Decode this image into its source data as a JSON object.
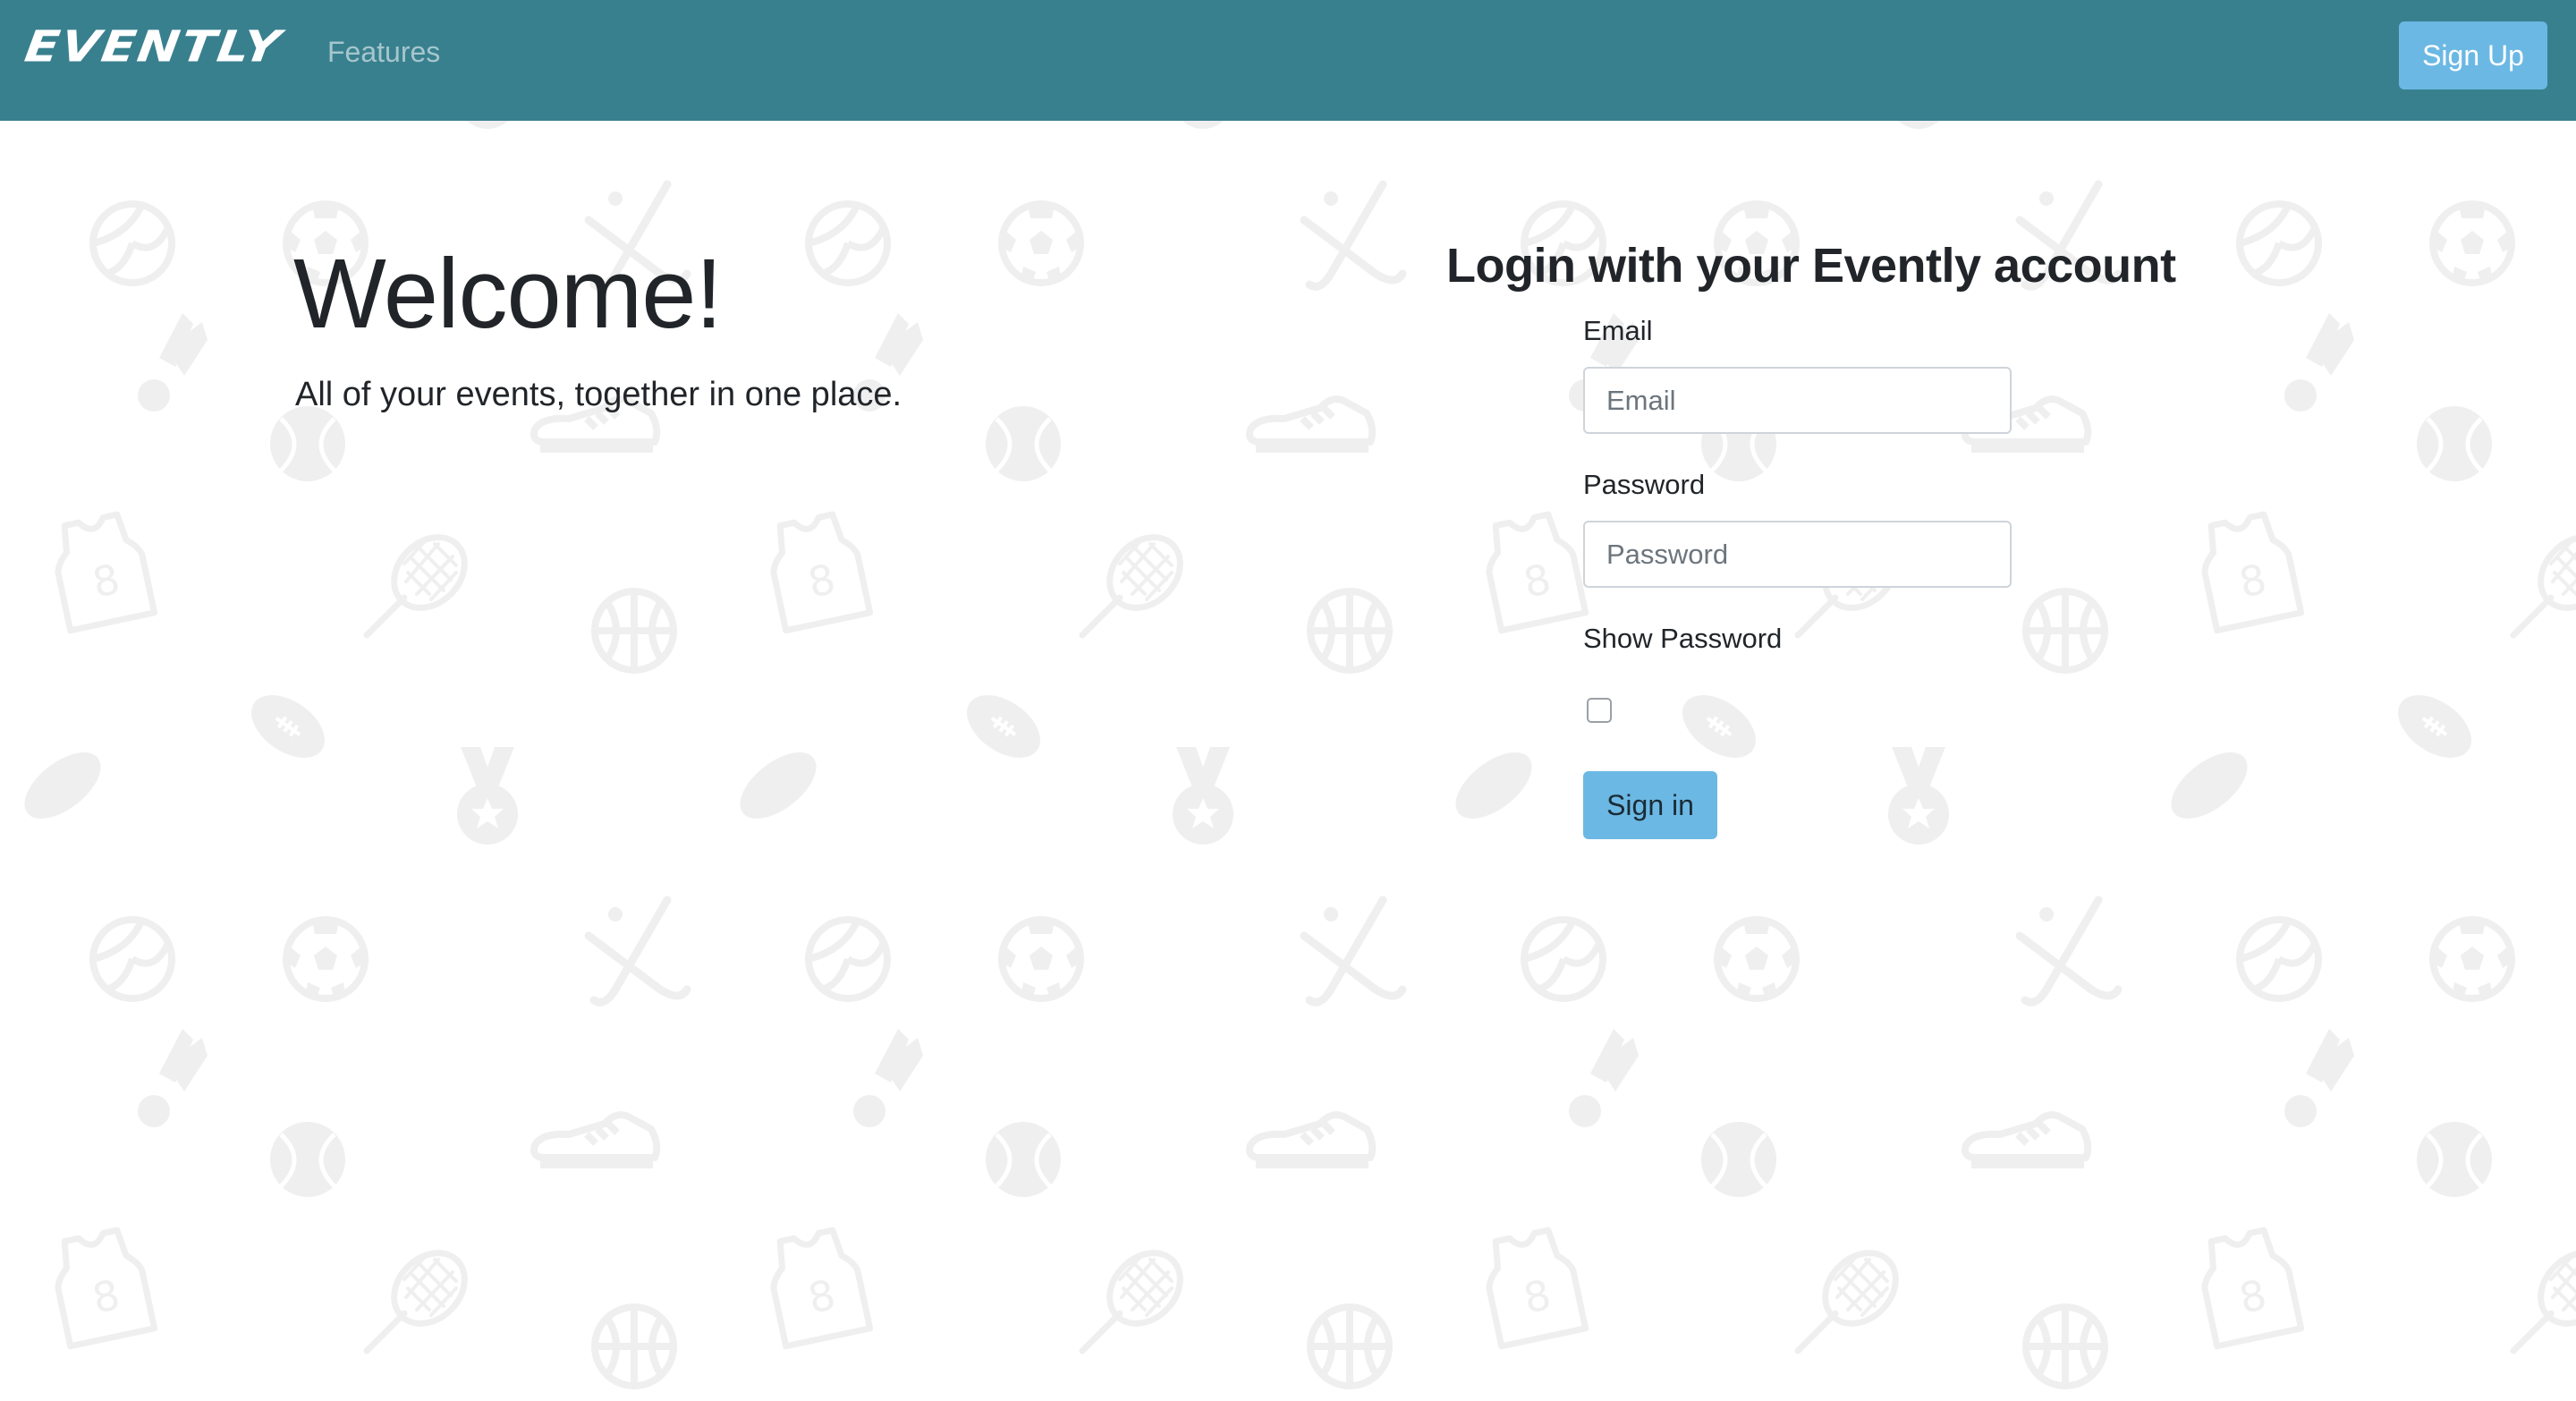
{
  "navbar": {
    "brand": "EVENTLY",
    "features_link": "Features",
    "signup_label": "Sign Up",
    "background_color": "#39808f",
    "button_color": "#6bb8e4"
  },
  "hero": {
    "title": "Welcome!",
    "subtitle": "All of your events, together in one place."
  },
  "login": {
    "heading": "Login with your Evently account",
    "email_label": "Email",
    "email_placeholder": "Email",
    "email_value": "",
    "password_label": "Password",
    "password_placeholder": "Password",
    "password_value": "",
    "show_password_label": "Show Password",
    "show_password_checked": false,
    "signin_label": "Sign in"
  },
  "background": {
    "pattern_icons": [
      "hockey-puck-icon",
      "football-icon",
      "medal-icon",
      "volleyball-icon",
      "soccer-ball-icon",
      "hockey-sticks-icon",
      "shuttlecock-icon",
      "tennis-ball-icon",
      "sneaker-icon",
      "jersey-icon",
      "tennis-racket-icon",
      "basketball-icon"
    ],
    "icon_color": "#f0f0f0"
  }
}
